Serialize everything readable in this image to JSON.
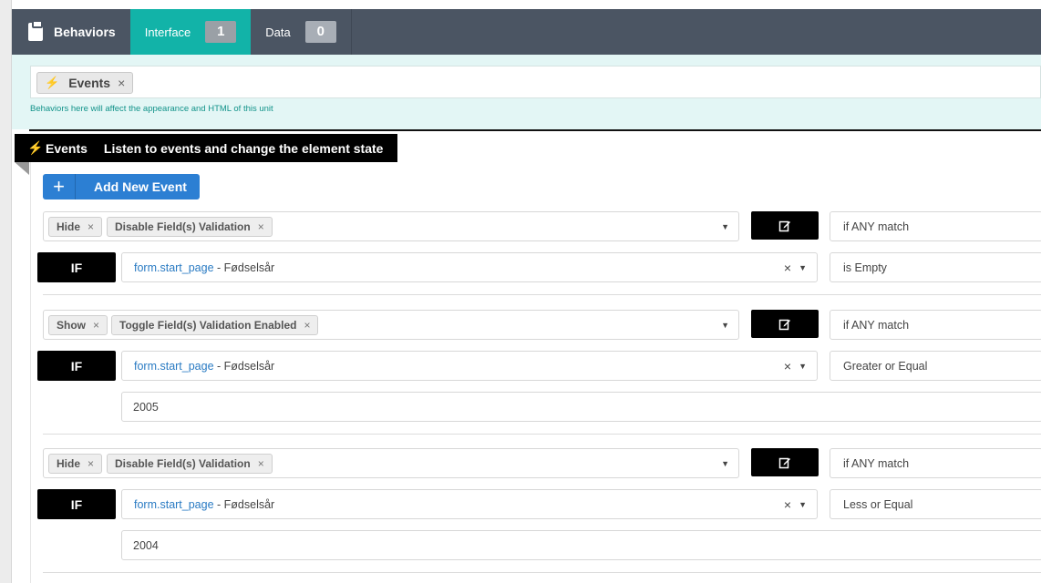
{
  "tabs": {
    "behaviors": "Behaviors",
    "interface_label": "Interface",
    "interface_count": "1",
    "data_label": "Data",
    "data_count": "0"
  },
  "filter": {
    "pill_label": "Events",
    "pill_remove": "×",
    "hint": "Behaviors here will affect the appearance and HTML of this unit"
  },
  "events_header": {
    "title": "Events",
    "description": "Listen to events and change the element state"
  },
  "add_button": {
    "plus": "+",
    "label": "Add New Event"
  },
  "rules": [
    {
      "actions": [
        "Hide",
        "Disable Field(s) Validation"
      ],
      "match": "if ANY match",
      "if_label": "IF",
      "field_ref": "form.start_page",
      "field_separator": " - ",
      "field_name": "Fødselsår",
      "operator": "is Empty",
      "value": ""
    },
    {
      "actions": [
        "Show",
        "Toggle Field(s) Validation Enabled"
      ],
      "match": "if ANY match",
      "if_label": "IF",
      "field_ref": "form.start_page",
      "field_separator": " - ",
      "field_name": "Fødselsår",
      "operator": "Greater or Equal",
      "value": "2005"
    },
    {
      "actions": [
        "Hide",
        "Disable Field(s) Validation"
      ],
      "match": "if ANY match",
      "if_label": "IF",
      "field_ref": "form.start_page",
      "field_separator": " - ",
      "field_name": "Fødselsår",
      "operator": "Less or Equal",
      "value": "2004"
    }
  ],
  "icons": {
    "tag_remove": "×",
    "clear": "×",
    "caret": "▼",
    "bolt": "⚡"
  },
  "colors": {
    "teal_accent": "#12b3a8",
    "topbar": "#4b5563",
    "primary_button": "#2c7fd3",
    "link": "#2a7bc3"
  }
}
